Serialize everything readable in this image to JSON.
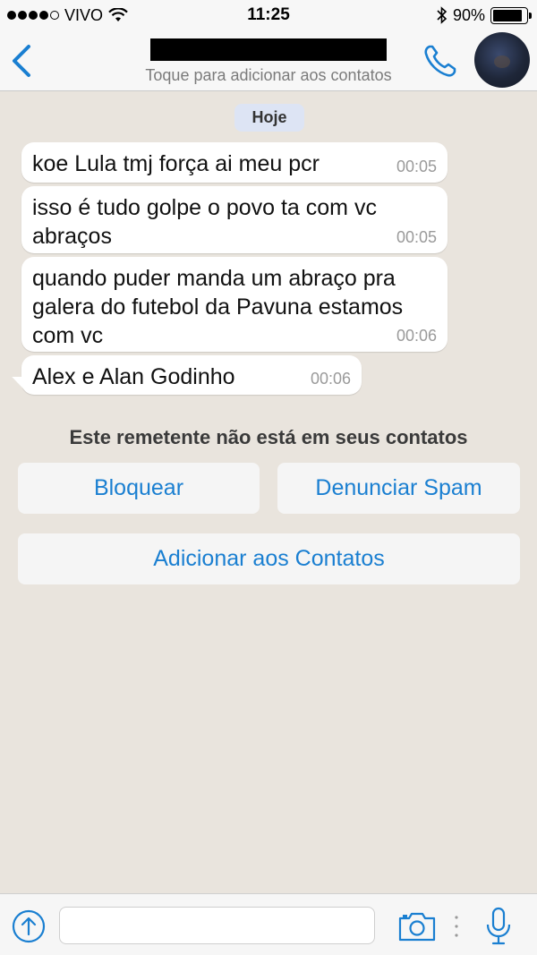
{
  "status_bar": {
    "carrier": "VIVO",
    "time": "11:25",
    "battery_percent_text": "90%",
    "battery_level": 0.9
  },
  "nav": {
    "subtitle": "Toque para adicionar aos contatos"
  },
  "chat": {
    "date_label": "Hoje",
    "messages": [
      {
        "text": "koe Lula tmj força ai meu pcr",
        "time": "00:05"
      },
      {
        "text": "isso é tudo golpe o povo ta com vc\nabraços",
        "time": "00:05"
      },
      {
        "text": "quando puder manda um abraço pra\ngalera do futebol da Pavuna estamos\ncom vc",
        "time": "00:06"
      },
      {
        "text": "Alex e Alan Godinho",
        "time": "00:06"
      }
    ]
  },
  "unknown_sender": {
    "notice": "Este remetente não está em seus contatos",
    "block_label": "Bloquear",
    "report_spam_label": "Denunciar Spam",
    "add_contact_label": "Adicionar aos Contatos"
  },
  "input_bar": {
    "placeholder": ""
  },
  "colors": {
    "accent": "#1a7fd1",
    "chat_background": "#e9e4dd",
    "date_pill": "#dde4f4"
  }
}
